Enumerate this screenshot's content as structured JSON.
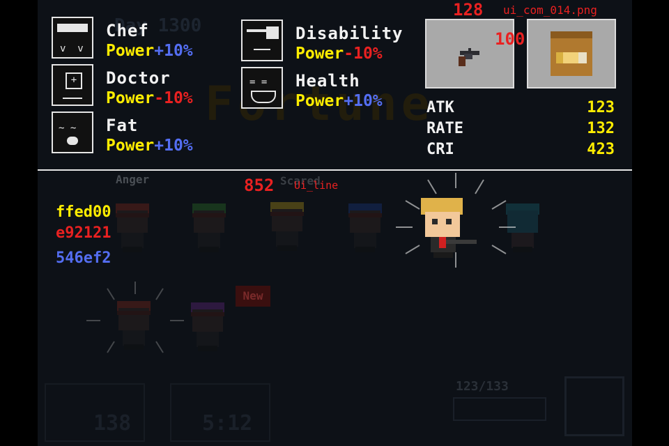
{
  "counters": {
    "top_value": "128",
    "slot_value": "100",
    "mid_value": "852"
  },
  "file_labels": {
    "top": "ui_com_014.png",
    "mid": "Ui_line"
  },
  "traits": [
    {
      "name": "Chef",
      "effect_label": "Power",
      "effect_value": "+10%"
    },
    {
      "name": "Doctor",
      "effect_label": "Power",
      "effect_value": "-10%"
    },
    {
      "name": "Fat",
      "effect_label": "Power",
      "effect_value": "+10%"
    },
    {
      "name": "Disability",
      "effect_label": "Power",
      "effect_value": "-10%"
    },
    {
      "name": "Health",
      "effect_label": "Power",
      "effect_value": "+10%"
    }
  ],
  "stats": [
    {
      "label": "ATK",
      "value": "123"
    },
    {
      "label": "RATE",
      "value": "132"
    },
    {
      "label": "CRI",
      "value": "423"
    }
  ],
  "color_legend": [
    "ffed00",
    "e92121",
    "546ef2"
  ],
  "colors": {
    "yellow": "#ffed00",
    "red": "#e92121",
    "blue": "#546ef2"
  },
  "background_labels": {
    "anger": "Anger",
    "scared": "Scared",
    "new": "New",
    "ammo": "123/133",
    "count_left": "138",
    "count_mid": "5:12",
    "day": "Day 1300"
  }
}
